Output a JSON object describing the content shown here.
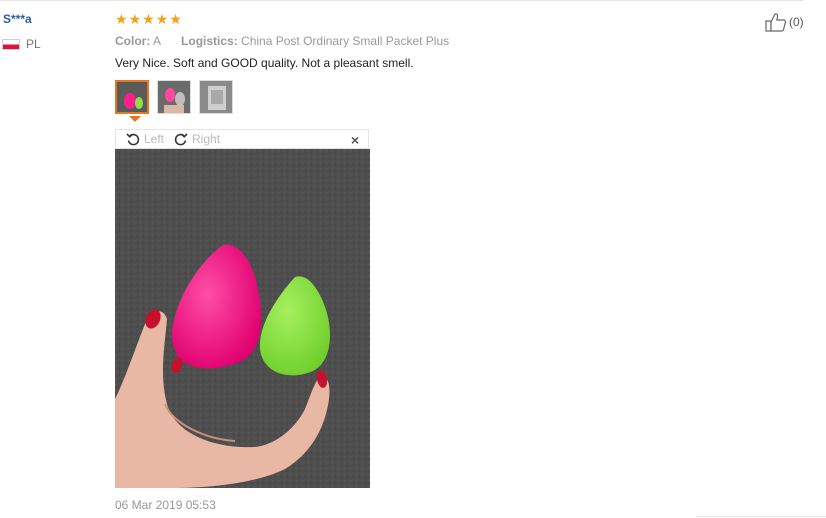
{
  "reviewer": {
    "name": "S***a",
    "country_code": "PL"
  },
  "rating": {
    "stars": 5,
    "max": 5,
    "color": "#f7a11a"
  },
  "meta": {
    "color_label": "Color:",
    "color_value": "A",
    "logistics_label": "Logistics:",
    "logistics_value": "China Post Ordinary Small Packet Plus"
  },
  "review": {
    "text": "Very Nice. Soft and GOOD quality. Not a pleasant smell."
  },
  "thumbnails": [
    {
      "active": true
    },
    {
      "active": false
    },
    {
      "active": false
    }
  ],
  "viewer": {
    "rotate_left_label": "Left",
    "rotate_right_label": "Right",
    "close_symbol": "×"
  },
  "date": "06 Mar 2019 05:53",
  "helpful": {
    "count_text": "(0)"
  },
  "colors": {
    "accent": "#e8761c",
    "username": "#2a5caa"
  }
}
